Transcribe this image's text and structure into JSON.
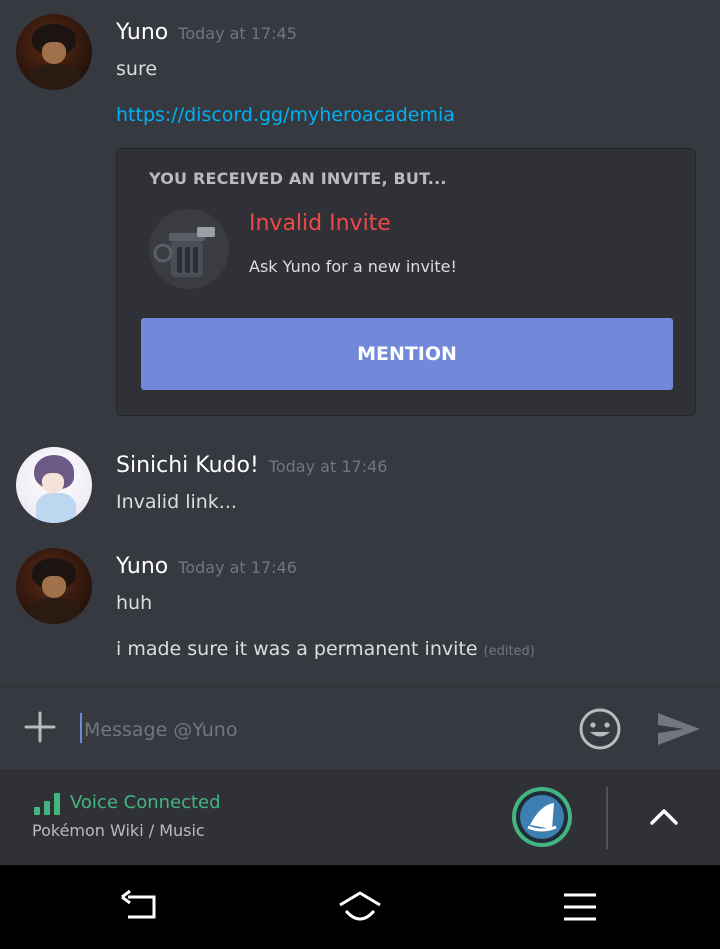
{
  "messages": [
    {
      "author": "Yuno",
      "timestamp": "Today at 17:45",
      "lines": [
        "sure"
      ],
      "link": "https://discord.gg/myheroacademia",
      "invite": {
        "header": "YOU RECEIVED AN INVITE, BUT...",
        "title": "Invalid Invite",
        "subtitle": "Ask Yuno for a new invite!",
        "button": "MENTION"
      }
    },
    {
      "author": "Sinichi Kudo!",
      "timestamp": "Today at 17:46",
      "lines": [
        "Invalid link..."
      ]
    },
    {
      "author": "Yuno",
      "timestamp": "Today at 17:46",
      "lines": [
        "huh",
        "i made sure it was a permanent invite"
      ],
      "edited": "(edited)"
    }
  ],
  "composer": {
    "placeholder": "Message @Yuno",
    "icons": [
      "plus-icon",
      "emoji-icon",
      "send-icon"
    ]
  },
  "voice": {
    "status": "Voice Connected",
    "channel": "Pokémon Wiki / Music"
  },
  "colors": {
    "background": "#36393f",
    "accent": "#7289da",
    "link": "#00b0f4",
    "error": "#f04747",
    "voice": "#43b581"
  }
}
